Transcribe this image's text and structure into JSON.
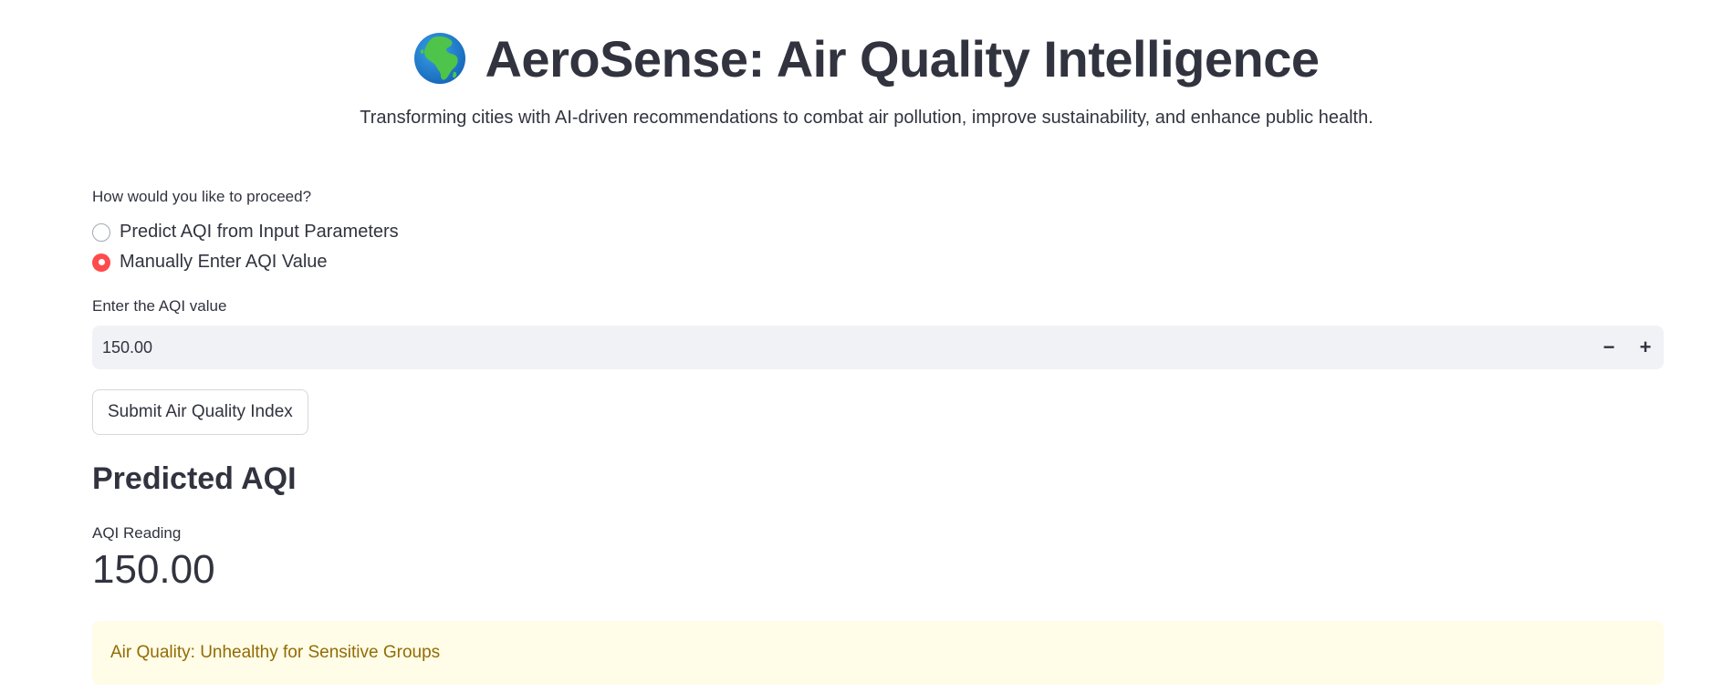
{
  "header": {
    "globe_icon": "globe-africa-icon",
    "title": "AeroSense: Air Quality Intelligence",
    "subtitle": "Transforming cities with AI-driven recommendations to combat air pollution, improve sustainability, and enhance public health."
  },
  "proceed": {
    "label": "How would you like to proceed?",
    "options": [
      {
        "label": "Predict AQI from Input Parameters",
        "selected": false
      },
      {
        "label": "Manually Enter AQI Value",
        "selected": true
      }
    ]
  },
  "aqi_input": {
    "label": "Enter the AQI value",
    "value": "150.00",
    "decrement_label": "−",
    "increment_label": "+"
  },
  "submit": {
    "label": "Submit Air Quality Index"
  },
  "result": {
    "section_title": "Predicted AQI",
    "metric_label": "AQI Reading",
    "metric_value": "150.00",
    "status_text": "Air Quality: Unhealthy for Sensitive Groups"
  },
  "colors": {
    "accent": "#ff4b4b",
    "text": "#31333f",
    "input_bg": "#f0f2f6",
    "warning_bg": "#fffce7",
    "warning_text": "#926c05"
  }
}
